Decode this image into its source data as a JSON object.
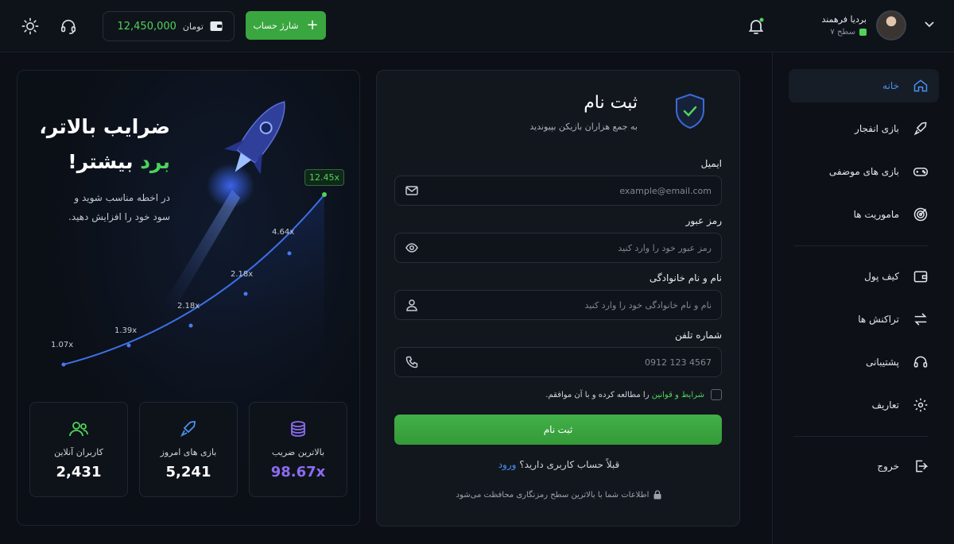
{
  "topbar": {
    "wallet_amount": "12,450,000",
    "wallet_currency": "تومان",
    "charge_label": "شارژ حساب",
    "user_name": "بردیا فرهمند",
    "user_level": "سطح ۷"
  },
  "sidebar": {
    "items": [
      {
        "label": "خانه",
        "icon": "home-icon"
      },
      {
        "label": "بازی انفجار",
        "icon": "rocket-icon"
      },
      {
        "label": "بازی های موضفی",
        "icon": "gamepad-icon"
      },
      {
        "label": "ماموریت ها",
        "icon": "target-icon"
      },
      {
        "label": "کیف پول",
        "icon": "wallet-icon"
      },
      {
        "label": "تراکنش ها",
        "icon": "arrows-icon"
      },
      {
        "label": "پشتیبانی",
        "icon": "headset-icon"
      },
      {
        "label": "تعاریف",
        "icon": "gear-icon"
      },
      {
        "label": "خروج",
        "icon": "logout-icon"
      }
    ]
  },
  "hero": {
    "title_line1": "ضرایب بالاتر،",
    "title_win": "برد",
    "title_more": "بیشتر!",
    "subtitle_line1": "در اخطه مناسب شوید و",
    "subtitle_line2": "سود خود را افزایش دهید.",
    "multipliers": [
      "1.07x",
      "1.39x",
      "2.18x",
      "2.18x",
      "4.64x",
      "12.45x"
    ]
  },
  "stats": [
    {
      "label": "کاربران آنلاین",
      "value": "2,431",
      "icon": "users-icon"
    },
    {
      "label": "بازی های امروز",
      "value": "5,241",
      "icon": "rocket-icon"
    },
    {
      "label": "بالاترین ضریب",
      "value": "98.67x",
      "icon": "coins-icon"
    }
  ],
  "form": {
    "title": "ثبت نام",
    "subtitle": "به جمع هزاران بازیکن بپیوندید",
    "email_label": "ایمیل",
    "email_placeholder": "example@email.com",
    "password_label": "رمز عبور",
    "password_placeholder": "رمز عبور خود را وارد کنید",
    "name_label": "نام و نام خانوادگی",
    "name_placeholder": "نام و نام خانوادگی خود را وارد کنید",
    "phone_label": "شماره تلفن",
    "phone_placeholder": "0912 123 4567",
    "terms_link": "شرایط و قوانین",
    "terms_text": "را مطالعه کرده و با آن موافقم.",
    "submit_label": "ثبت نام",
    "have_account": "قبلاً حساب کاربری دارید؟",
    "login_link": "ورود",
    "secure_note": "اطلاعات شما با بالاترین سطح رمزنگاری محافظت می‌شود"
  },
  "colors": {
    "accent_green": "#4fd35a",
    "accent_blue": "#4a90f0",
    "accent_purple": "#8b6cf0"
  }
}
